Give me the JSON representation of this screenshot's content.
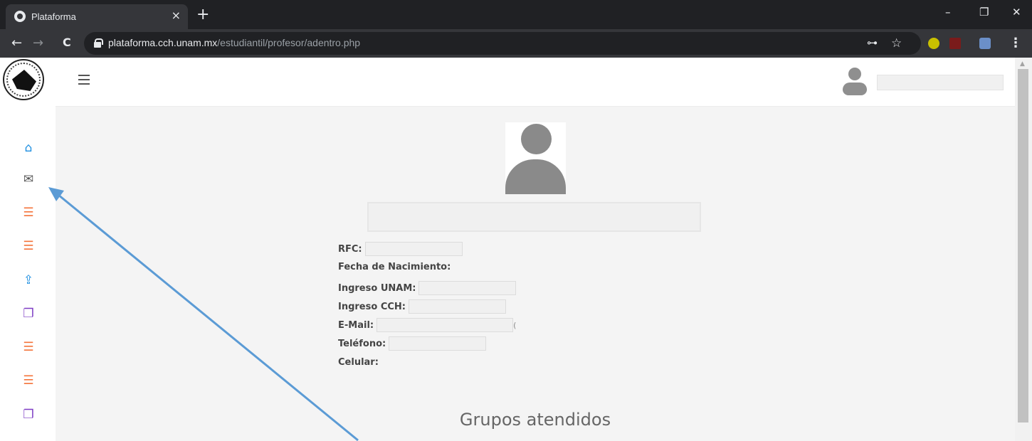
{
  "browser": {
    "tab_title": "Plataforma",
    "tab_close": "×",
    "new_tab": "+",
    "url_host": "plataforma.cch.unam.mx",
    "url_path": "/estudiantil/profesor/adentro.php",
    "minimize": "–",
    "restore": "❐",
    "close": "✕",
    "back": "←",
    "forward": "→",
    "reload": "C",
    "key_icon": "⊶",
    "star_icon": "☆",
    "menu_icon": "⋮"
  },
  "sidebar": {
    "items": [
      {
        "icon": "home-icon",
        "glyph": "⌂",
        "color": "#1e8fe1"
      },
      {
        "icon": "mail-icon",
        "glyph": "✉",
        "color": "#555555"
      },
      {
        "icon": "list-icon",
        "glyph": "☰",
        "color": "#f4743b"
      },
      {
        "icon": "list-icon",
        "glyph": "☰",
        "color": "#f4743b"
      },
      {
        "icon": "share-icon",
        "glyph": "⇪",
        "color": "#1e8fe1"
      },
      {
        "icon": "copy-icon",
        "glyph": "❐",
        "color": "#7d3cc4"
      },
      {
        "icon": "list-icon",
        "glyph": "☰",
        "color": "#f4743b"
      },
      {
        "icon": "list-icon",
        "glyph": "☰",
        "color": "#f4743b"
      },
      {
        "icon": "copy-icon",
        "glyph": "❐",
        "color": "#7d3cc4"
      }
    ]
  },
  "profile": {
    "rfc_label": "RFC:",
    "birth_label": "Fecha de Nacimiento:",
    "ingreso_unam_label": "Ingreso UNAM:",
    "ingreso_cch_label": "Ingreso CCH:",
    "email_label": "E-Mail:",
    "email_tail": "(",
    "phone_label": "Teléfono:",
    "cell_label": "Celular:"
  },
  "section_title": "Grupos atendidos",
  "annotation": {
    "color": "#5b9bd5"
  }
}
